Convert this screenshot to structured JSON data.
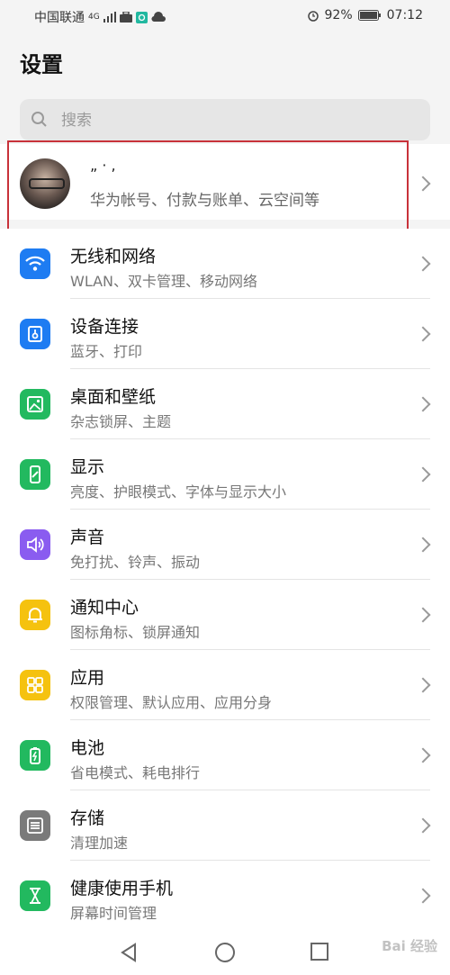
{
  "status_bar": {
    "carrier": "中国联通",
    "network": "4G",
    "battery": "92%",
    "time": "07:12"
  },
  "page": {
    "title": "设置"
  },
  "search": {
    "placeholder": "搜索"
  },
  "profile": {
    "name": "„  ·  ,",
    "subtitle": "华为帐号、付款与账单、云空间等"
  },
  "items": [
    {
      "title": "无线和网络",
      "subtitle": "WLAN、双卡管理、移动网络",
      "icon": "wifi-icon",
      "color": "#1e7cf2"
    },
    {
      "title": "设备连接",
      "subtitle": "蓝牙、打印",
      "icon": "device-connection-icon",
      "color": "#1e7cf2"
    },
    {
      "title": "桌面和壁纸",
      "subtitle": "杂志锁屏、主题",
      "icon": "wallpaper-icon",
      "color": "#22b95f"
    },
    {
      "title": "显示",
      "subtitle": "亮度、护眼模式、字体与显示大小",
      "icon": "display-icon",
      "color": "#22b95f"
    },
    {
      "title": "声音",
      "subtitle": "免打扰、铃声、振动",
      "icon": "sound-icon",
      "color": "#8a5cf0"
    },
    {
      "title": "通知中心",
      "subtitle": "图标角标、锁屏通知",
      "icon": "bell-icon",
      "color": "#f5c20f"
    },
    {
      "title": "应用",
      "subtitle": "权限管理、默认应用、应用分身",
      "icon": "apps-icon",
      "color": "#f5c20f"
    },
    {
      "title": "电池",
      "subtitle": "省电模式、耗电排行",
      "icon": "battery-icon",
      "color": "#22b95f"
    },
    {
      "title": "存储",
      "subtitle": "清理加速",
      "icon": "storage-icon",
      "color": "#7a7a7a"
    },
    {
      "title": "健康使用手机",
      "subtitle": "屏幕时间管理",
      "icon": "hourglass-icon",
      "color": "#22b95f"
    }
  ],
  "watermark": "Bai 经验"
}
